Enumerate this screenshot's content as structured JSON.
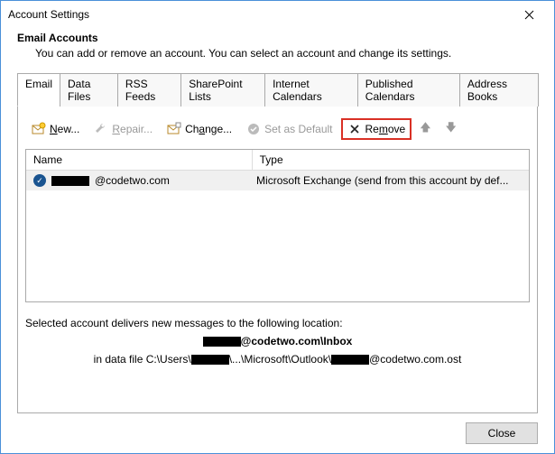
{
  "window": {
    "title": "Account Settings"
  },
  "header": {
    "heading": "Email Accounts",
    "subheading": "You can add or remove an account. You can select an account and change its settings."
  },
  "tabs": {
    "items": [
      {
        "label": "Email",
        "active": true
      },
      {
        "label": "Data Files"
      },
      {
        "label": "RSS Feeds"
      },
      {
        "label": "SharePoint Lists"
      },
      {
        "label": "Internet Calendars"
      },
      {
        "label": "Published Calendars"
      },
      {
        "label": "Address Books"
      }
    ]
  },
  "toolbar": {
    "new": "New...",
    "repair": "Repair...",
    "change": "Change...",
    "set_default": "Set as Default",
    "remove": "Remove"
  },
  "table": {
    "col_name": "Name",
    "col_type": "Type",
    "rows": [
      {
        "name_suffix": "@codetwo.com",
        "type": "Microsoft Exchange (send from this account by def..."
      }
    ]
  },
  "location": {
    "intro": "Selected account delivers new messages to the following location:",
    "mailbox_suffix": "@codetwo.com\\Inbox",
    "datafile_prefix": "in data file C:\\Users\\",
    "datafile_mid": "\\...\\Microsoft\\Outlook\\",
    "datafile_suffix": "@codetwo.com.ost"
  },
  "footer": {
    "close": "Close"
  }
}
